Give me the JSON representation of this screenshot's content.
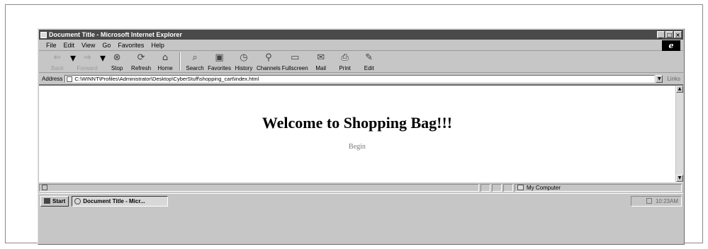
{
  "window": {
    "title": "Document Title - Microsoft Internet Explorer",
    "controls": {
      "minimize": "_",
      "maximize": "□",
      "close": "×"
    }
  },
  "menu": [
    "File",
    "Edit",
    "View",
    "Go",
    "Favorites",
    "Help"
  ],
  "ie_logo": "e",
  "toolbar": {
    "back": "Back",
    "forward": "Forward",
    "stop": "Stop",
    "refresh": "Refresh",
    "home": "Home",
    "search": "Search",
    "favorites": "Favorites",
    "history": "History",
    "channels": "Channels",
    "fullscreen": "Fullscreen",
    "mail": "Mail",
    "print": "Print",
    "edit": "Edit"
  },
  "address": {
    "label": "Address",
    "value": "C:\\WINNT\\Profiles\\Administrator\\Desktop\\CyberStuff\\shopping_cart\\index.html",
    "links_label": "Links"
  },
  "page": {
    "heading": "Welcome to Shopping Bag!!!",
    "begin_link": "Begin"
  },
  "status": {
    "zone": "My Computer"
  },
  "taskbar": {
    "start": "Start",
    "task": "Document Title - Micr...",
    "clock": "10:23AM"
  },
  "icons": {
    "back": "back-arrow-icon",
    "forward": "forward-arrow-icon",
    "stop": "stop-icon",
    "refresh": "refresh-icon",
    "home": "home-icon",
    "search": "search-icon",
    "favorites": "favorites-icon",
    "history": "history-icon",
    "channels": "channels-icon",
    "fullscreen": "fullscreen-icon",
    "mail": "mail-icon",
    "print": "print-icon",
    "edit": "edit-icon"
  }
}
